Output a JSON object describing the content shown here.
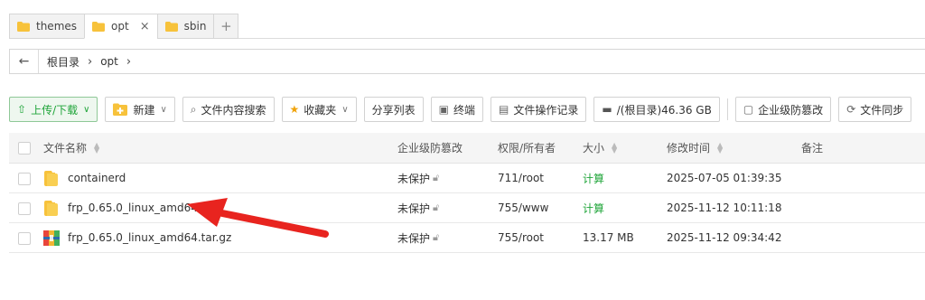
{
  "tabs": [
    {
      "label": "themes",
      "active": false
    },
    {
      "label": "opt",
      "active": true
    },
    {
      "label": "sbin",
      "active": false
    }
  ],
  "tab_close": "×",
  "tab_add": "+",
  "breadcrumb": {
    "back": "←",
    "items": [
      "根目录",
      "opt"
    ],
    "separator": "›"
  },
  "toolbar": {
    "upload": "上传/下载",
    "new": "新建",
    "search": "文件内容搜索",
    "favorites": "收藏夹",
    "share_list": "分享列表",
    "terminal": "终端",
    "file_log": "文件操作记录",
    "disk": "/(根目录)46.36 GB",
    "protection": "企业级防篡改",
    "sync": "文件同步"
  },
  "table": {
    "headers": {
      "name": "文件名称",
      "protection": "企业级防篡改",
      "permission": "权限/所有者",
      "size": "大小",
      "mtime": "修改时间",
      "note": "备注"
    },
    "rows": [
      {
        "name": "containerd",
        "type": "folder",
        "protection": "未保护",
        "permission": "711/root",
        "size": "计算",
        "mtime": "2025-07-05 01:39:35",
        "note": ""
      },
      {
        "name": "frp_0.65.0_linux_amd64",
        "type": "folder",
        "protection": "未保护",
        "permission": "755/www",
        "size": "计算",
        "mtime": "2025-11-12 10:11:18",
        "note": ""
      },
      {
        "name": "frp_0.65.0_linux_amd64.tar.gz",
        "type": "archive",
        "protection": "未保护",
        "permission": "755/root",
        "size": "13.17 MB",
        "mtime": "2025-11-12 09:34:42",
        "note": ""
      }
    ]
  },
  "colors": {
    "accent_green": "#20a53a",
    "folder": "#f7c23b",
    "arrow": "#e8241f"
  }
}
